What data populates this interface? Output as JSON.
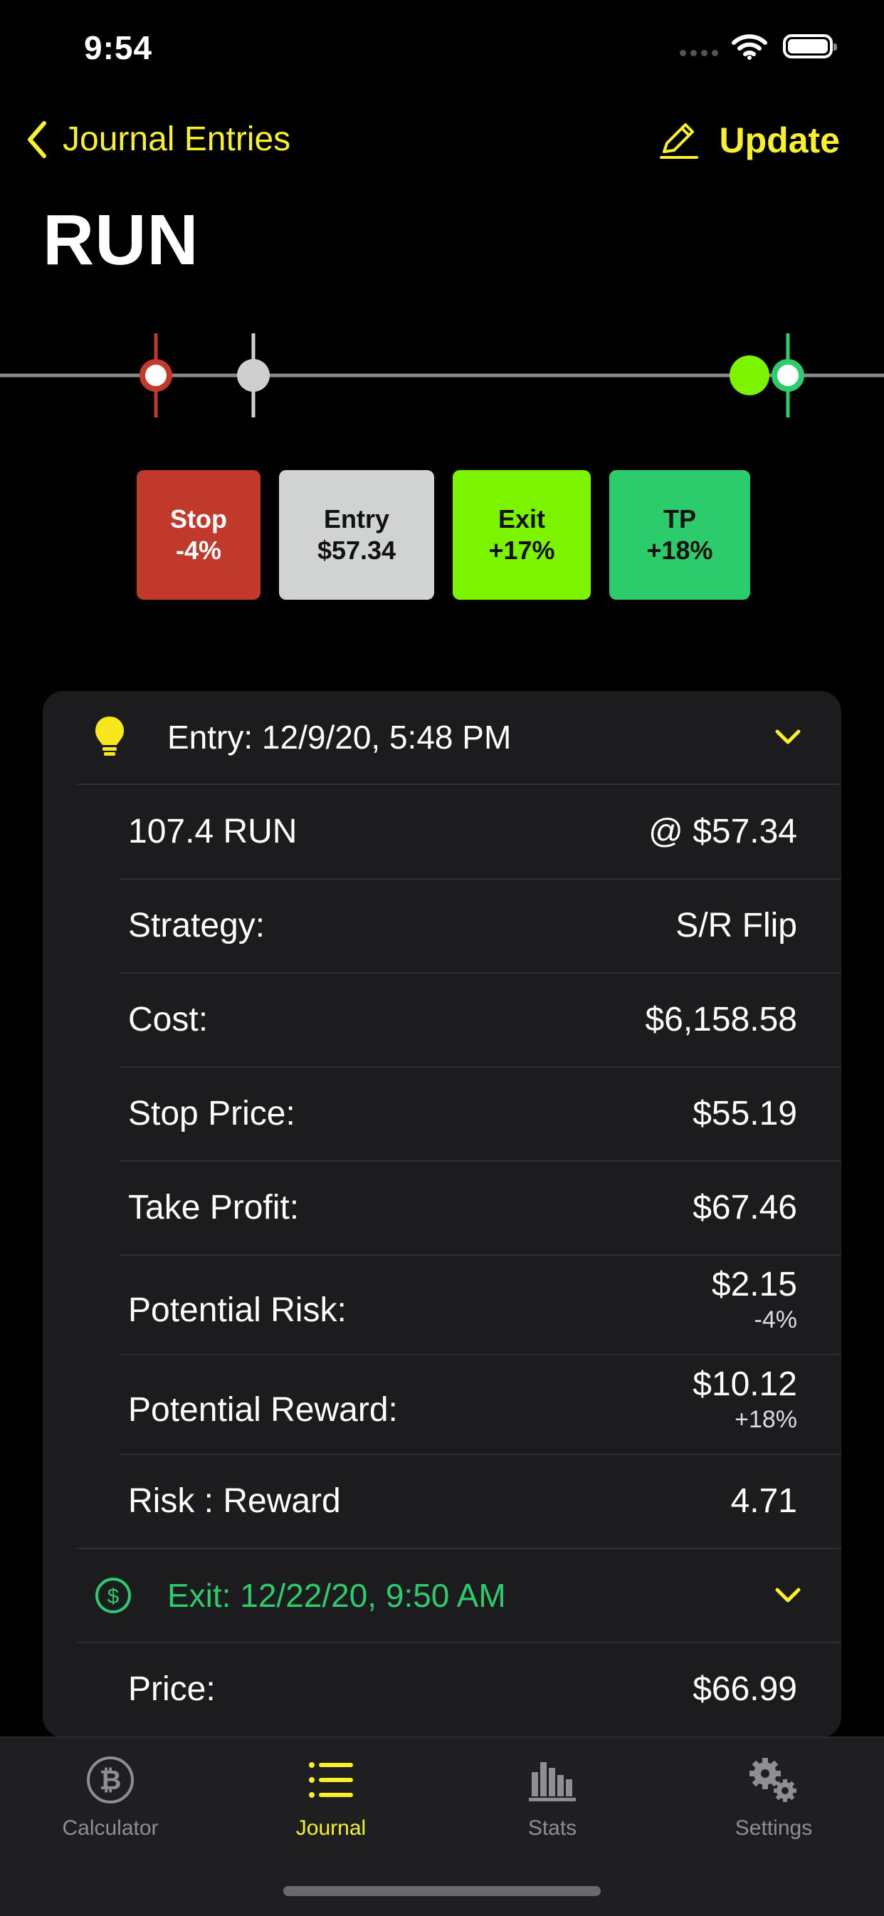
{
  "status": {
    "time": "9:54"
  },
  "nav": {
    "back_label": "Journal Entries",
    "action_label": "Update"
  },
  "title": "RUN",
  "price_boxes": {
    "stop": {
      "label": "Stop",
      "value": "-4%",
      "color": "#c0392b"
    },
    "entry": {
      "label": "Entry",
      "value": "$57.34",
      "color": "#d1d3d2"
    },
    "exit": {
      "label": "Exit",
      "value": "+17%",
      "color": "#7cf400"
    },
    "tp": {
      "label": "TP",
      "value": "+18%",
      "color": "#2ccb6c"
    }
  },
  "entry_section": {
    "icon": "lightbulb-icon",
    "header": "Entry: 12/9/20, 5:48 PM",
    "position": {
      "qty": "107.4 RUN",
      "price": "@ $57.34"
    },
    "rows": [
      {
        "label": "Strategy:",
        "value": "S/R Flip"
      },
      {
        "label": "Cost:",
        "value": "$6,158.58"
      },
      {
        "label": "Stop Price:",
        "value": "$55.19"
      },
      {
        "label": "Take Profit:",
        "value": "$67.46"
      },
      {
        "label": "Potential Risk:",
        "value": "$2.15",
        "sub": "-4%"
      },
      {
        "label": "Potential Reward:",
        "value": "$10.12",
        "sub": "+18%"
      },
      {
        "label": "Risk : Reward",
        "value": "4.71"
      }
    ]
  },
  "exit_section": {
    "icon": "dollar-circle-icon",
    "header": "Exit: 12/22/20, 9:50 AM",
    "rows": [
      {
        "label": "Price:",
        "value": "$66.99"
      }
    ]
  },
  "tabs": [
    {
      "label": "Calculator",
      "icon": "bitcoin-icon",
      "active": false
    },
    {
      "label": "Journal",
      "icon": "list-icon",
      "active": true
    },
    {
      "label": "Stats",
      "icon": "bar-chart-icon",
      "active": false
    },
    {
      "label": "Settings",
      "icon": "gears-icon",
      "active": false
    }
  ],
  "colors": {
    "accent": "#f8f12a",
    "exit_green": "#2ccb6c",
    "card_bg": "#1c1c1e"
  }
}
